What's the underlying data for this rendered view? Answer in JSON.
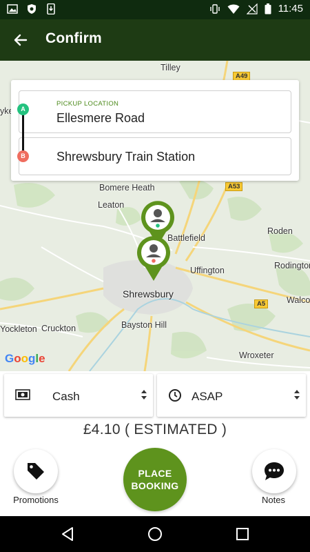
{
  "status_bar": {
    "time": "11:45",
    "icons": [
      "image-icon",
      "shield-icon",
      "phone-download-icon",
      "vibrate-icon",
      "wifi-icon",
      "no-sim-icon",
      "battery-icon"
    ]
  },
  "app_bar": {
    "title": "Confirm",
    "back_icon": "arrow-left-icon"
  },
  "map": {
    "places": [
      "Tilley",
      "yke",
      "Bomere Heath",
      "Leaton",
      "Battlefield",
      "Roden",
      "Uffington",
      "Rodington",
      "Shrewsbury",
      "Walco",
      "Yockleton",
      "Cruckton",
      "Bayston Hill",
      "Wroxeter"
    ],
    "road_badges": [
      "A49",
      "A53",
      "A5"
    ],
    "attribution": "Google"
  },
  "locations": {
    "pickup_caption": "PICKUP LOCATION",
    "pickup_value": "Ellesmere Road",
    "pickup_marker": "A",
    "dropoff_value": "Shrewsbury Train Station",
    "dropoff_marker": "B"
  },
  "payment": {
    "selected": "Cash",
    "icon": "cash-icon"
  },
  "time": {
    "selected": "ASAP",
    "icon": "clock-icon"
  },
  "price": {
    "text": "£4.10 ( ESTIMATED )"
  },
  "actions": {
    "promotions_label": "Promotions",
    "place_booking_line1": "PLACE",
    "place_booking_line2": "BOOKING",
    "notes_label": "Notes"
  },
  "nav_bar": {
    "icons": [
      "back-triangle-icon",
      "home-circle-icon",
      "recents-square-icon"
    ]
  },
  "colors": {
    "status_bar": "#0f2b0f",
    "app_bar": "#1e3b14",
    "accent_green": "#5e931d",
    "marker_a": "#23c27f",
    "marker_b": "#ef6d5f"
  }
}
